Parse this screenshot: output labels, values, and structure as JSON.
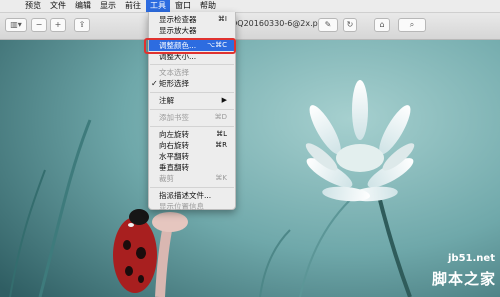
{
  "menubar": {
    "items": [
      "预览",
      "文件",
      "编辑",
      "显示",
      "前往",
      "工具",
      "窗口",
      "帮助"
    ],
    "active": "工具"
  },
  "toolbar": {
    "file_title": "QQ20160330-6@2x.png"
  },
  "tools_menu": {
    "items": [
      {
        "label": "显示检查器",
        "shortcut": "⌘I",
        "disabled": false
      },
      {
        "label": "显示放大器",
        "shortcut": "",
        "disabled": false
      },
      {
        "label": "调整颜色...",
        "shortcut": "⌥⌘C",
        "disabled": false,
        "highlighted": true
      },
      {
        "label": "调整大小...",
        "shortcut": "",
        "disabled": false
      },
      {
        "label": "文本选择",
        "shortcut": "",
        "disabled": true
      },
      {
        "label": "矩形选择",
        "shortcut": "",
        "disabled": false,
        "checked": true
      },
      {
        "label": "注解",
        "shortcut": "▶",
        "disabled": false
      },
      {
        "label": "添加书签",
        "shortcut": "⌘D",
        "disabled": true
      },
      {
        "label": "向左旋转",
        "shortcut": "⌘L",
        "disabled": false
      },
      {
        "label": "向右旋转",
        "shortcut": "⌘R",
        "disabled": false
      },
      {
        "label": "水平翻转",
        "shortcut": "",
        "disabled": false
      },
      {
        "label": "垂直翻转",
        "shortcut": "",
        "disabled": false
      },
      {
        "label": "裁剪",
        "shortcut": "⌘K",
        "disabled": true
      },
      {
        "label": "指派描述文件...",
        "shortcut": "",
        "disabled": false
      },
      {
        "label": "显示位置信息",
        "shortcut": "",
        "disabled": true
      }
    ]
  },
  "watermark": {
    "site": "jb51.net",
    "name": "脚本之家"
  },
  "colors": {
    "highlight": "#2d6ce0",
    "annotation_box": "#e0322f",
    "photo_bg": "#5fa2a6"
  }
}
